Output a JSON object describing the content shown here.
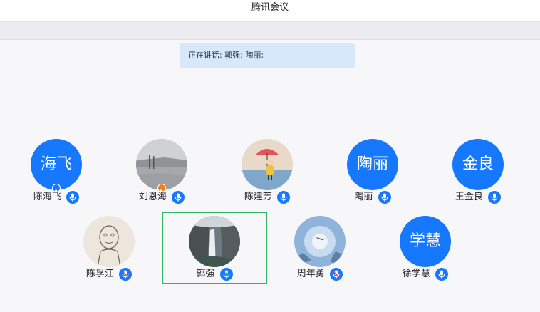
{
  "window": {
    "title": "腾讯会议"
  },
  "banner": {
    "speaking_text": "正在讲话: 郭强; 陶丽;"
  },
  "participants": [
    {
      "name": "陈海飞",
      "avatar_text": "海飞",
      "avatar_type": "text",
      "mic": "blue",
      "badge": "person"
    },
    {
      "name": "刘恩海",
      "avatar_type": "photo-lake",
      "mic": "blue",
      "badge": "person-orange"
    },
    {
      "name": "陈建芳",
      "avatar_type": "photo-umbrella-girl",
      "mic": "blue"
    },
    {
      "name": "陶丽",
      "avatar_text": "陶丽",
      "avatar_type": "text",
      "mic": "blue"
    },
    {
      "name": "王金良",
      "avatar_text": "金良",
      "avatar_type": "text",
      "mic": "blue"
    },
    {
      "name": "陈孚江",
      "avatar_type": "photo-sketch",
      "mic": "blue-muted"
    },
    {
      "name": "郭强",
      "avatar_type": "photo-waterfall",
      "mic": "green-speaking",
      "active": true
    },
    {
      "name": "周年勇",
      "avatar_type": "photo-sky-plane",
      "mic": "blue-muted"
    },
    {
      "name": "徐学慧",
      "avatar_text": "学慧",
      "avatar_type": "text",
      "mic": "blue"
    }
  ],
  "colors": {
    "accent": "#1677ff",
    "speaking": "#2fb563",
    "banner_bg": "#d7e8fb",
    "badge_orange": "#f07d1a"
  }
}
